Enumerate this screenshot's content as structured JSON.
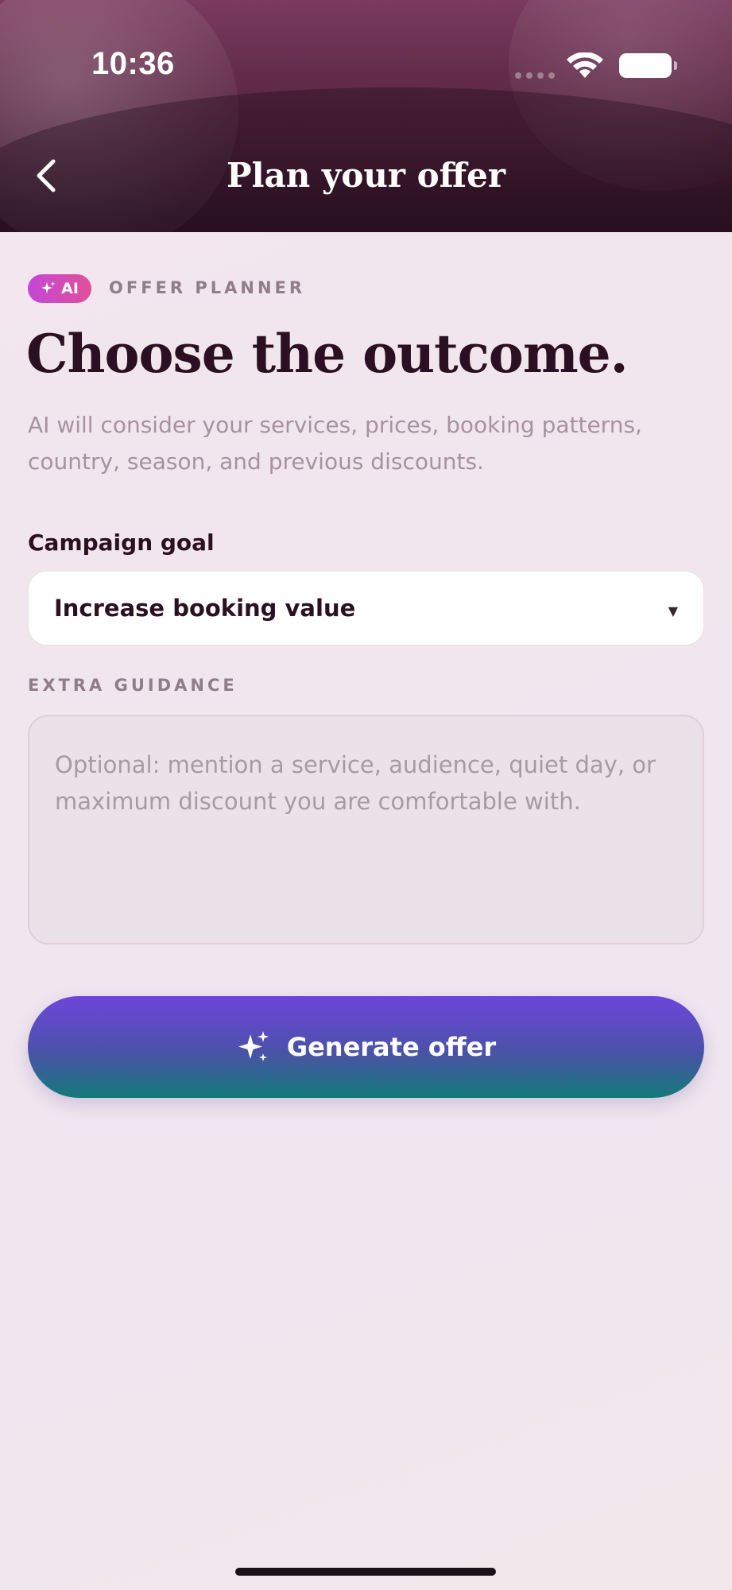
{
  "status_bar": {
    "time": "10:36"
  },
  "nav": {
    "title": "Plan your offer",
    "back_icon": "chevron-left-icon"
  },
  "badge": {
    "label": "AI",
    "icon": "sparkle-icon"
  },
  "eyebrow": "OFFER PLANNER",
  "headline": "Choose the outcome.",
  "subtitle": "AI will consider your services, prices, booking patterns, country, season, and previous discounts.",
  "campaign_goal": {
    "label": "Campaign goal",
    "selected": "Increase booking value",
    "icon": "caret-down-icon"
  },
  "extra_guidance": {
    "label": "EXTRA GUIDANCE",
    "placeholder": "Optional: mention a service, audience, quiet day, or maximum discount you are comfortable with.",
    "value": ""
  },
  "generate_button": {
    "label": "Generate offer",
    "icon": "sparkles-icon"
  },
  "colors": {
    "header_top": "#7a3a5e",
    "header_bottom": "#2e1424",
    "headline_text": "#2a1020",
    "badge_gradient_start": "#c447d6",
    "badge_gradient_end": "#e0509a",
    "button_gradient_top": "#6d45dc",
    "button_gradient_bottom": "#147a7a"
  }
}
